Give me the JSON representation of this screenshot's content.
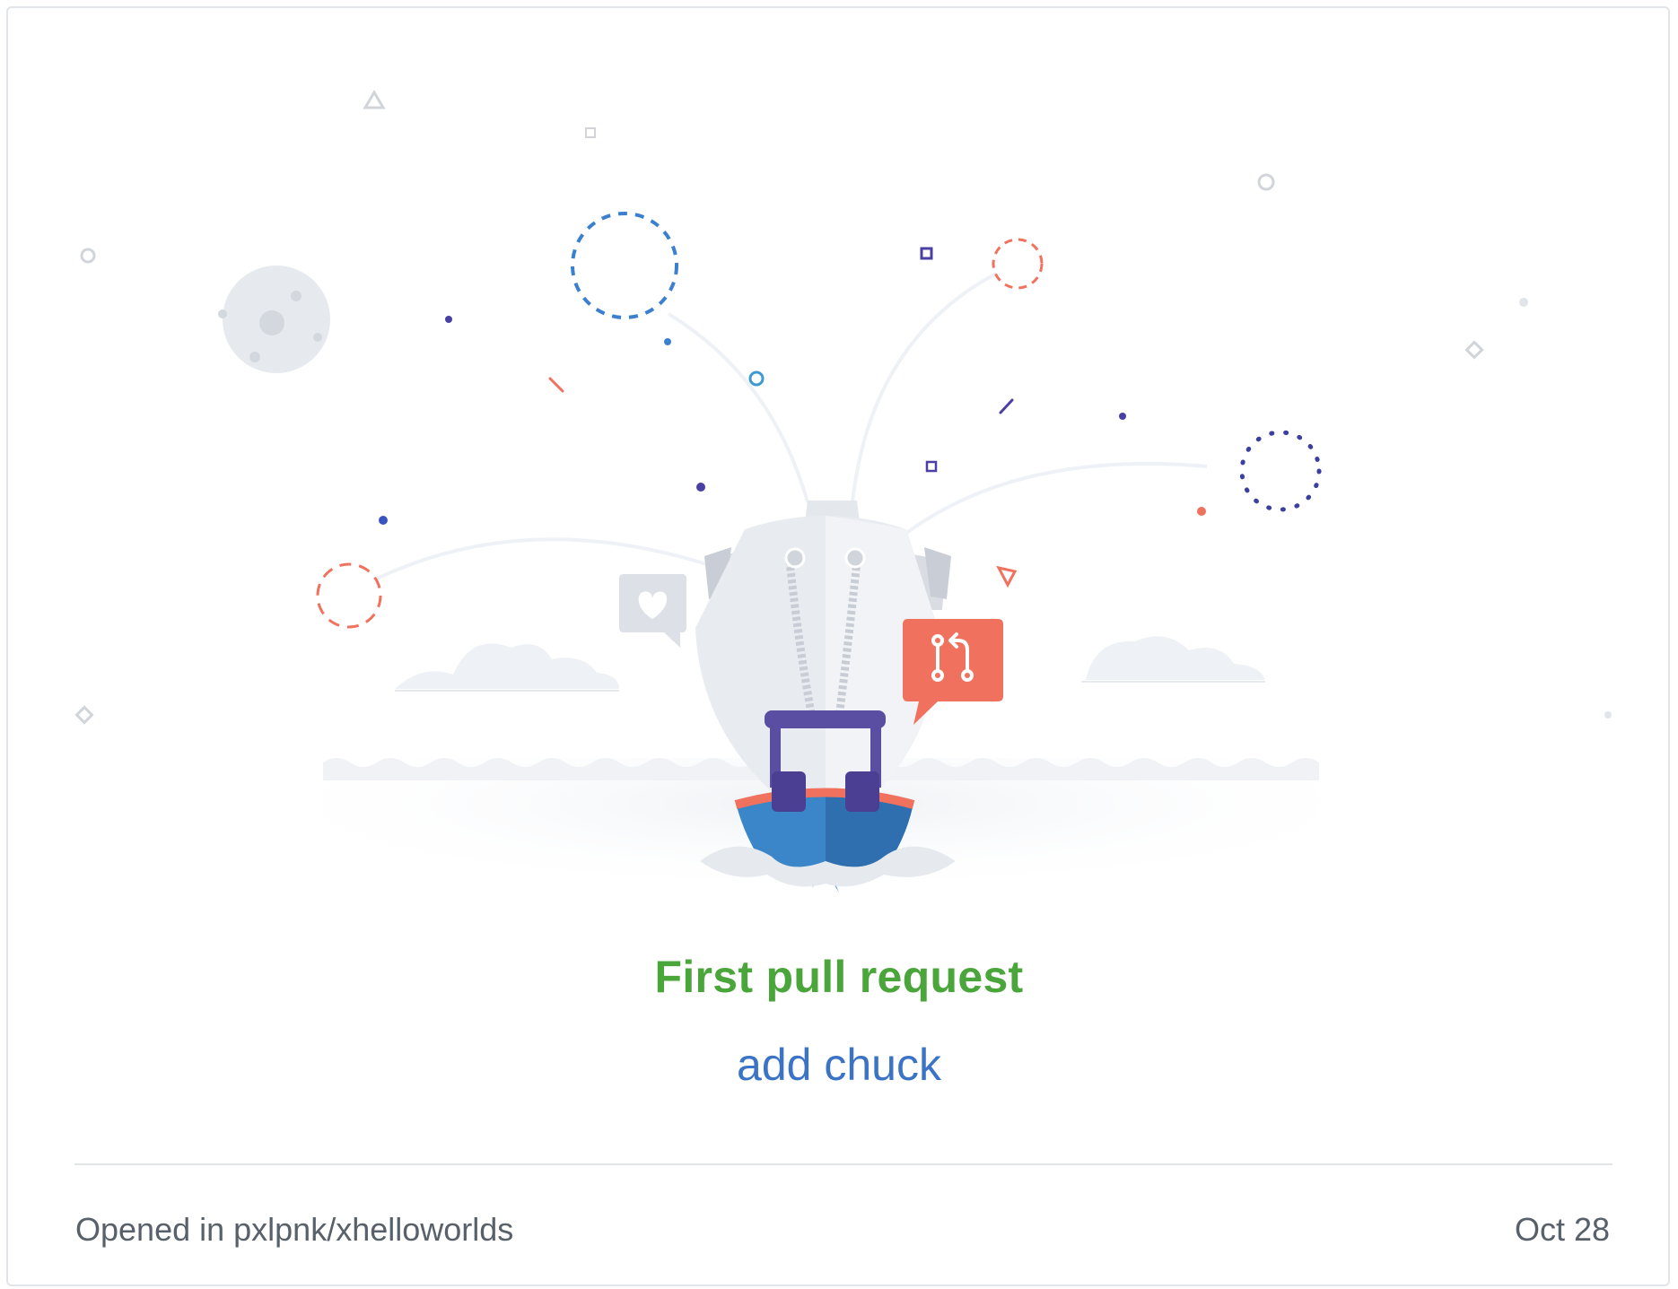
{
  "achievement": {
    "title": "First pull request",
    "pull_request_title": "add chuck"
  },
  "footer": {
    "opened_prefix": "Opened in ",
    "repo": "pxlpnk/xhelloworlds",
    "date": "Oct 28"
  },
  "illustration": {
    "icons": [
      "moon-icon",
      "heart-speech-bubble-icon",
      "pull-request-speech-bubble-icon",
      "boat-icon",
      "confetti-icon",
      "cloud-icon"
    ]
  },
  "colors": {
    "title_green": "#4aa53a",
    "link_blue": "#3b73c6",
    "pr_badge_red": "#f0725e",
    "boat_purple": "#5a4ea3",
    "boat_blue": "#3a86c8",
    "muted_text": "#586069",
    "border_gray": "#e1e4e8"
  }
}
